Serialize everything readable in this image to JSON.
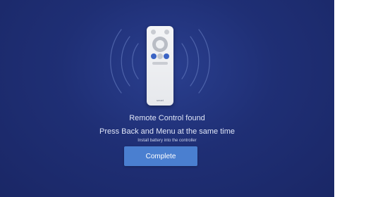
{
  "screen": {
    "title": "Remote Control found",
    "instruction": "Press Back and Menu at the same time",
    "hint": "Install battery into the controller"
  },
  "remote": {
    "brand": "smart"
  },
  "actions": {
    "complete_label": "Complete"
  },
  "colors": {
    "background": "#1f2f75",
    "button": "#4a7fd0",
    "remote_accent": "#3b64c4"
  }
}
